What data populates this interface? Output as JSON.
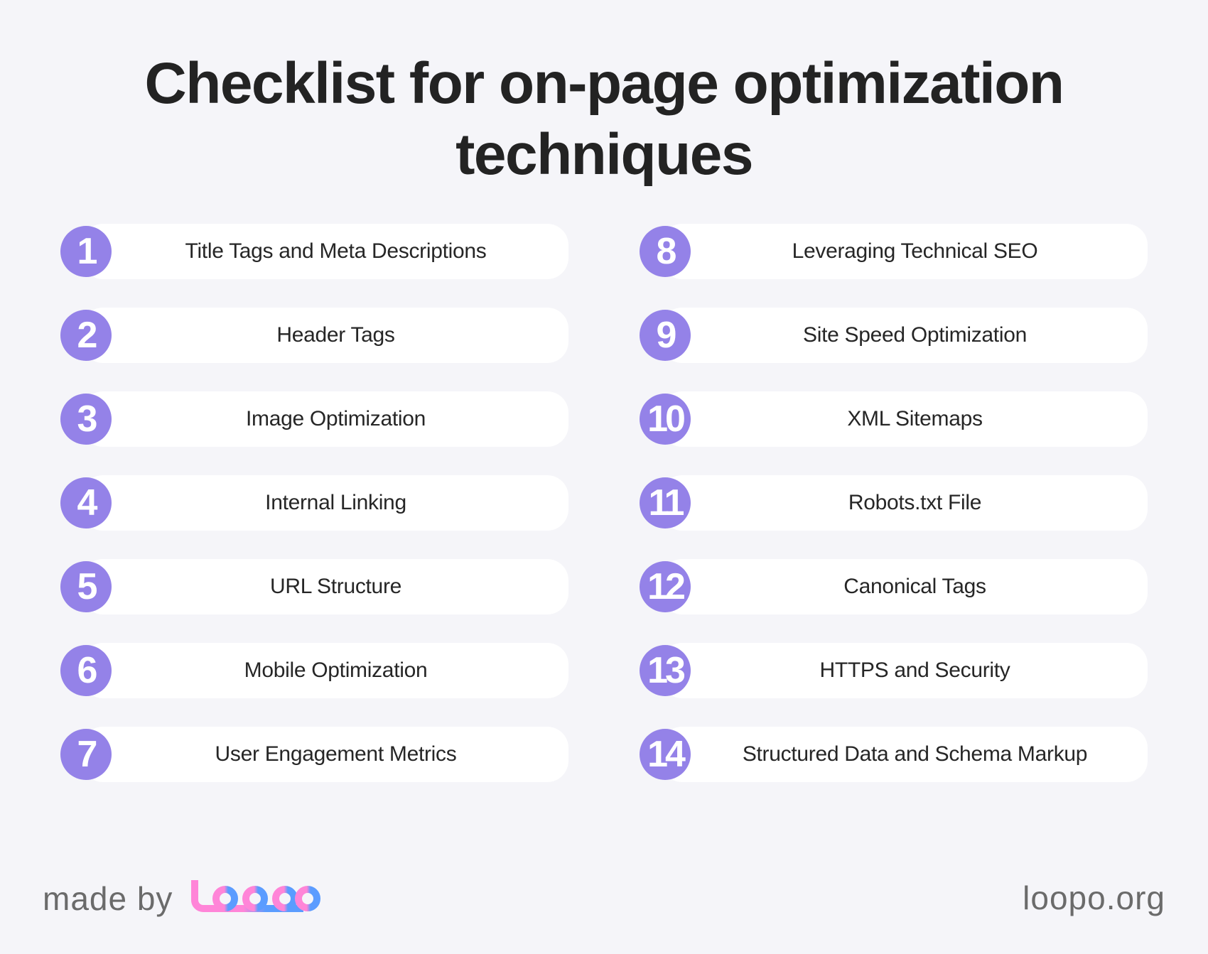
{
  "title_line1": "Checklist for on-page optimization",
  "title_line2": "techniques",
  "items": [
    {
      "num": "1",
      "label": "Title Tags and Meta Descriptions"
    },
    {
      "num": "2",
      "label": "Header Tags"
    },
    {
      "num": "3",
      "label": "Image Optimization"
    },
    {
      "num": "4",
      "label": "Internal Linking"
    },
    {
      "num": "5",
      "label": "URL Structure"
    },
    {
      "num": "6",
      "label": "Mobile Optimization"
    },
    {
      "num": "7",
      "label": "User Engagement Metrics"
    },
    {
      "num": "8",
      "label": "Leveraging Technical SEO"
    },
    {
      "num": "9",
      "label": "Site Speed Optimization"
    },
    {
      "num": "10",
      "label": "XML Sitemaps"
    },
    {
      "num": "11",
      "label": "Robots.txt File"
    },
    {
      "num": "12",
      "label": "Canonical Tags"
    },
    {
      "num": "13",
      "label": "HTTPS and Security"
    },
    {
      "num": "14",
      "label": "Structured Data and Schema Markup"
    }
  ],
  "footer": {
    "made_by": "made by",
    "logo_text": "loopo",
    "site": "loopo.org"
  },
  "colors": {
    "background": "#f5f5f9",
    "badge": "#9482e8",
    "pill": "#ffffff",
    "logo_pink": "#ff85d8",
    "logo_blue": "#5b9cff"
  }
}
